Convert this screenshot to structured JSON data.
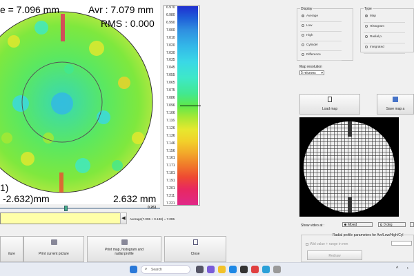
{
  "map": {
    "pv_text": "e = 7.096 mm",
    "avr_text": "Avr : 7.079 mm",
    "rms_text": "RMS : 0.000",
    "index_text": "1)",
    "coord_text": "-2.632)mm",
    "size_text": "2.632 mm"
  },
  "scale": {
    "labels": [
      "6.970",
      "6.980",
      "6.990",
      "7.000",
      "7.010",
      "7.020",
      "7.030",
      "7.035",
      "7.045",
      "7.055",
      "7.065",
      "7.075",
      "7.086",
      "7.096",
      "7.106",
      "7.116",
      "7.126",
      "7.136",
      "7.146",
      "7.156",
      "7.161",
      "7.171",
      "7.181",
      "7.191",
      "7.201",
      "7.211",
      "7.221"
    ],
    "selected": "7.096",
    "slider_value": "0.261",
    "slider_fraction": 0.4
  },
  "average_text": "Average(7.095 + 0.136) = 7.095",
  "buttons": {
    "picture": "iture",
    "print_current": "Print current picture",
    "print_map": "Print map, histogram and radial profile",
    "close": "Close",
    "load_map": "Load map",
    "save_map": "Save map a"
  },
  "display": {
    "title": "Display",
    "options": [
      "Average",
      "Low",
      "High",
      "Cylinder",
      "Difference"
    ],
    "selected": "Average"
  },
  "type": {
    "title": "Type",
    "options": [
      "Map",
      "Histogram",
      "Radial p.",
      "Integrated"
    ],
    "selected": "Map"
  },
  "resolution": {
    "label": "Map resolution",
    "value": "5 microns"
  },
  "video": {
    "label": "Show video at :",
    "options": [
      "Mixed",
      "0 deg"
    ],
    "selected": "Mixed"
  },
  "radial": {
    "title": "Radial profile parameters for Avr/Low/High/Cyl",
    "checkbox_label": "Wid value + range in mm",
    "button": "Redraw"
  },
  "taskbar": {
    "search_placeholder": "Search"
  },
  "colors": {
    "scale_selected": "#000000",
    "slider_panel": "#ffffa8"
  }
}
